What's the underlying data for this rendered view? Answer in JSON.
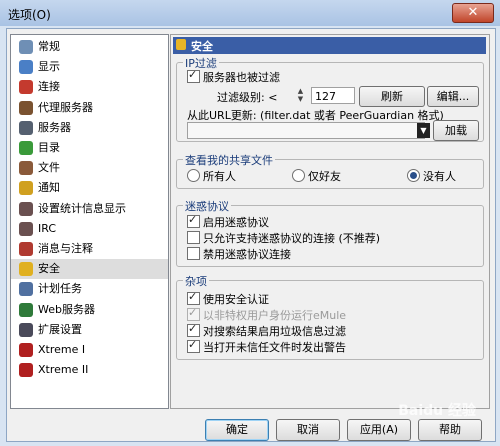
{
  "window": {
    "title": "选项(O)",
    "close_symbol": "✕"
  },
  "nav": {
    "items": [
      {
        "label": "常规",
        "icon": "general-icon",
        "color": "#6f8fb5"
      },
      {
        "label": "显示",
        "icon": "display-icon",
        "color": "#4a7fc6"
      },
      {
        "label": "连接",
        "icon": "connection-icon",
        "color": "#c43a2e"
      },
      {
        "label": "代理服务器",
        "icon": "proxy-icon",
        "color": "#7a5230"
      },
      {
        "label": "服务器",
        "icon": "server-icon",
        "color": "#556070"
      },
      {
        "label": "目录",
        "icon": "directory-icon",
        "color": "#3a9a3a"
      },
      {
        "label": "文件",
        "icon": "file-icon",
        "color": "#8a5a3a"
      },
      {
        "label": "通知",
        "icon": "notify-icon",
        "color": "#d0a020"
      },
      {
        "label": "设置统计信息显示",
        "icon": "stats-icon",
        "color": "#6a5050"
      },
      {
        "label": "IRC",
        "icon": "irc-icon",
        "color": "#6a5050"
      },
      {
        "label": "消息与注释",
        "icon": "messages-icon",
        "color": "#b03a30"
      },
      {
        "label": "安全",
        "icon": "lock-icon",
        "color": "#e0b020"
      },
      {
        "label": "计划任务",
        "icon": "schedule-icon",
        "color": "#5070a0"
      },
      {
        "label": "Web服务器",
        "icon": "webserver-icon",
        "color": "#2f7a3a"
      },
      {
        "label": "扩展设置",
        "icon": "extended-icon",
        "color": "#4a4a5a"
      },
      {
        "label": "Xtreme I",
        "icon": "xtreme-icon",
        "color": "#b02020"
      },
      {
        "label": "Xtreme II",
        "icon": "xtreme-icon",
        "color": "#b02020"
      }
    ],
    "selected_index": 11
  },
  "panel": {
    "title": "安全",
    "ipfilter": {
      "title": "IP过滤",
      "server_filter_label": "服务器也被过滤",
      "level_label": "过滤级别: <",
      "level_value": "127",
      "refresh_label": "刷新",
      "edit_label": "编辑...",
      "url_label": "从此URL更新: (filter.dat 或者 PeerGuardian 格式)",
      "url_value": "",
      "load_label": "加载"
    },
    "shared": {
      "title": "查看我的共享文件",
      "options": [
        "所有人",
        "仅好友",
        "没有人"
      ],
      "selected": 2
    },
    "obfuscation": {
      "title": "迷惑协议",
      "items": [
        {
          "label": "启用迷惑协议",
          "checked": true
        },
        {
          "label": "只允许支持迷惑协议的连接 (不推荐)",
          "checked": false
        },
        {
          "label": "禁用迷惑协议连接",
          "checked": false
        }
      ]
    },
    "misc": {
      "title": "杂项",
      "items": [
        {
          "label": "使用安全认证",
          "checked": true,
          "disabled": false
        },
        {
          "label": "以非特权用户身份运行eMule",
          "checked": true,
          "disabled": true
        },
        {
          "label": "对搜索结果启用垃圾信息过滤",
          "checked": true,
          "disabled": false
        },
        {
          "label": "当打开未信任文件时发出警告",
          "checked": true,
          "disabled": false
        }
      ]
    }
  },
  "footer": {
    "ok": "确定",
    "cancel": "取消",
    "apply": "应用(A)",
    "help": "帮助"
  },
  "watermark": "Baidu 经验"
}
